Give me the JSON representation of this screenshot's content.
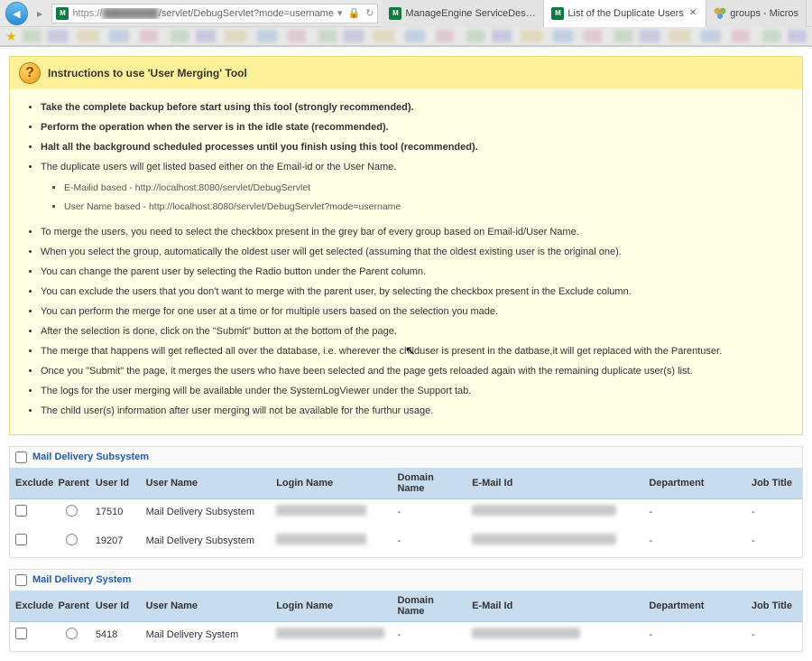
{
  "browser": {
    "url_protocol": "https://",
    "url_host_blur": "████████",
    "url_path": "/servlet/DebugServlet?mode=username",
    "tabs": [
      {
        "label": "ManageEngine ServiceDesk ...",
        "active": false,
        "icon": "me"
      },
      {
        "label": "List of the Duplicate Users",
        "active": true,
        "icon": "me"
      },
      {
        "label": "groups - Micros",
        "active": false,
        "icon": "groups"
      }
    ]
  },
  "instructions": {
    "title": "Instructions to use 'User Merging' Tool",
    "items": [
      {
        "text": "Take the complete backup before start using this tool (strongly recommended).",
        "style": "red-bold"
      },
      {
        "text": "Perform the operation when the server is in the idle state (recommended).",
        "style": "black-bold"
      },
      {
        "text": "Halt all the background scheduled processes until you finish using this tool (recommended).",
        "style": "black-bold"
      },
      {
        "text": "The duplicate users will get listed based either on the Email-id or the User Name.",
        "style": "",
        "sub": [
          "E-Mailid based - http://localhost:8080/servlet/DebugServlet",
          "User Name based - http://localhost:8080/servlet/DebugServlet?mode=username"
        ]
      },
      {
        "text": "To merge the users, you need to select the checkbox present in the grey bar of every group based on Email-id/User Name."
      },
      {
        "text": "When you select the group, automatically the oldest user will get selected (assuming that the oldest existing user is the original one)."
      },
      {
        "text": "You can change the parent user by selecting the Radio button under the Parent column."
      },
      {
        "text": "You can exclude the users that you don't want to merge with the parent user, by selecting the checkbox present in the Exclude column."
      },
      {
        "text": "You can perform the merge for one user at a time or for multiple users based on the selection you made."
      },
      {
        "text": "After the selection is done, click on the \"Submit\" button at the bottom of the page."
      },
      {
        "text": "The merge that happens will get reflected all over the database, i.e. wherever the childuser is present in the datbase,it will get replaced with the Parentuser."
      },
      {
        "text": "Once you \"Submit\" the page, it merges the users who have been selected and the page gets reloaded again with the remaining duplicate user(s) list."
      },
      {
        "text": "The logs for the user merging will be available under the SystemLogViewer under the Support tab."
      },
      {
        "text": "The child user(s) information after user merging will not be available for the furthur usage."
      }
    ]
  },
  "columns": {
    "exclude": "Exclude",
    "parent": "Parent",
    "userid": "User Id",
    "username": "User Name",
    "login": "Login Name",
    "domain": "Domain Name",
    "email": "E-Mail Id",
    "dept": "Department",
    "job": "Job Title"
  },
  "groups": [
    {
      "title": "Mail Delivery Subsystem",
      "rows": [
        {
          "userid": "17510",
          "username": "Mail Delivery Subsystem",
          "login_blur": 100,
          "domain": "-",
          "email_blur": 160,
          "dept": "-",
          "job": "-",
          "parent": false
        },
        {
          "userid": "19207",
          "username": "Mail Delivery Subsystem",
          "login_blur": 100,
          "domain": "-",
          "email_blur": 160,
          "dept": "-",
          "job": "-",
          "parent": false
        }
      ]
    },
    {
      "title": "Mail Delivery System",
      "rows": [
        {
          "userid": "5418",
          "username": "Mail Delivery System",
          "login_blur": 120,
          "domain": "-",
          "email_blur": 120,
          "dept": "-",
          "job": "-",
          "parent": false
        }
      ]
    }
  ]
}
